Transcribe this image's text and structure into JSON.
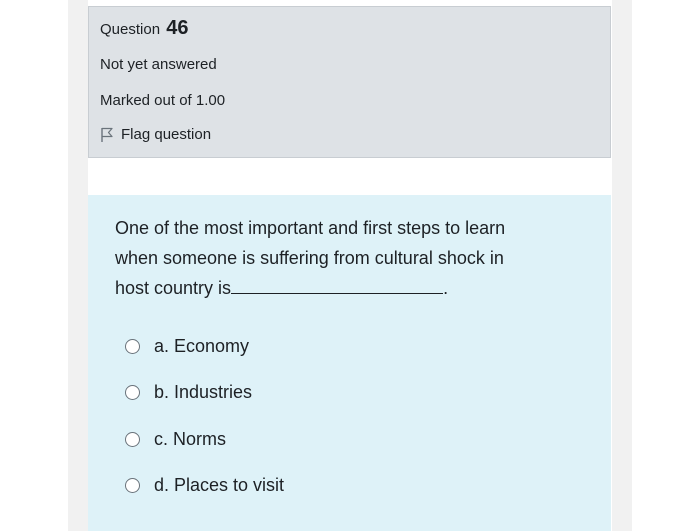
{
  "question": {
    "label": "Question",
    "number": "46",
    "status": "Not yet answered",
    "marks": "Marked out of 1.00",
    "flag_label": "Flag question"
  },
  "prompt": {
    "line1": "One of the most important and first steps to learn",
    "line2": "when someone is suffering from cultural shock in",
    "line3_prefix": "host country is",
    "line3_suffix": "."
  },
  "options": [
    {
      "label": "a. Economy"
    },
    {
      "label": "b. Industries"
    },
    {
      "label": "c. Norms"
    },
    {
      "label": "d. Places to visit"
    }
  ],
  "colors": {
    "info_background": "#dee2e6",
    "content_background": "#def2f8",
    "text": "#1d2125"
  },
  "icons": {
    "flag": "flag-outline-icon",
    "option": "radio-unchecked-icon"
  }
}
